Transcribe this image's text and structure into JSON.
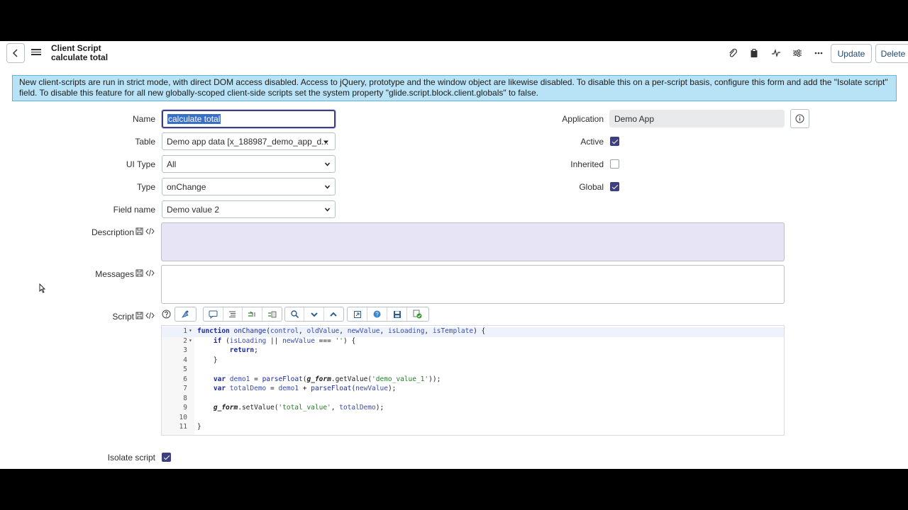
{
  "header": {
    "record_type": "Client Script",
    "record_name": "calculate total",
    "update_label": "Update",
    "delete_label": "Delete"
  },
  "banner": {
    "text": "New client-scripts are run in strict mode, with direct DOM access disabled. Access to jQuery, prototype and the window object are likewise disabled. To disable this on a per-script basis, configure this form and add the \"Isolate script\" field. To disable this feature for all new globally-scoped client-side scripts set the system property \"glide.script.block.client.globals\" to false."
  },
  "form": {
    "name": {
      "label": "Name",
      "value": "calculate total"
    },
    "table": {
      "label": "Table",
      "value": "Demo app data [x_188987_demo_app_d..."
    },
    "ui_type": {
      "label": "UI Type",
      "value": "All"
    },
    "type": {
      "label": "Type",
      "value": "onChange"
    },
    "field_name": {
      "label": "Field name",
      "value": "Demo value 2"
    },
    "description": {
      "label": "Description",
      "value": ""
    },
    "messages": {
      "label": "Messages",
      "value": ""
    },
    "script": {
      "label": "Script"
    },
    "application": {
      "label": "Application",
      "value": "Demo App"
    },
    "active": {
      "label": "Active",
      "checked": true
    },
    "inherited": {
      "label": "Inherited",
      "checked": false
    },
    "global": {
      "label": "Global",
      "checked": true
    },
    "isolate_script": {
      "label": "Isolate script",
      "checked": true
    }
  },
  "code_lines": [
    {
      "n": "1",
      "fold": "▾",
      "text": "function onChange(control, oldValue, newValue, isLoading, isTemplate) {"
    },
    {
      "n": "2",
      "fold": "▾",
      "text": "    if (isLoading || newValue === '') {"
    },
    {
      "n": "3",
      "fold": "",
      "text": "        return;"
    },
    {
      "n": "4",
      "fold": "",
      "text": "    }"
    },
    {
      "n": "5",
      "fold": "",
      "text": ""
    },
    {
      "n": "6",
      "fold": "",
      "text": "    var demo1 = parseFloat(g_form.getValue('demo_value_1'));"
    },
    {
      "n": "7",
      "fold": "",
      "text": "    var totalDemo = demo1 + parseFloat(newValue);"
    },
    {
      "n": "8",
      "fold": "",
      "text": ""
    },
    {
      "n": "9",
      "fold": "",
      "text": "    g_form.setValue('total_value', totalDemo);"
    },
    {
      "n": "10",
      "fold": "",
      "text": ""
    },
    {
      "n": "11",
      "fold": "",
      "text": "}"
    }
  ],
  "colors": {
    "accent": "#3d3f7f",
    "banner_bg": "#b8e2f5",
    "description_bg": "#e6e4f5",
    "readonly_bg": "#e9eaec"
  }
}
